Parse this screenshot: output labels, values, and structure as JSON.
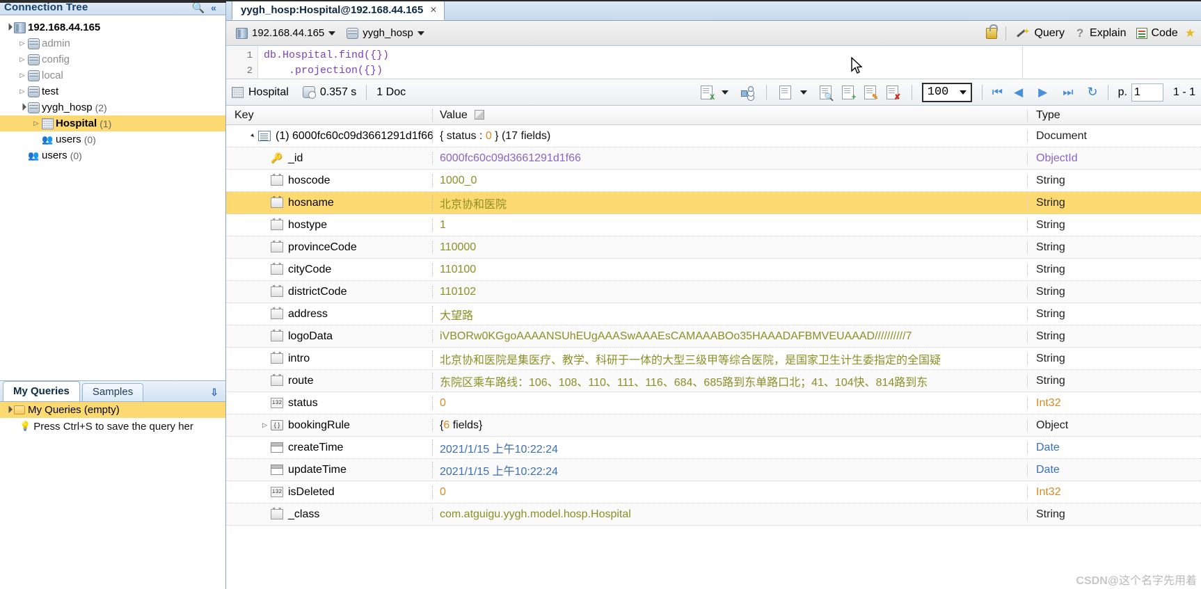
{
  "left_panel": {
    "header": {
      "title": "Connection Tree",
      "search_icon": "search-icon",
      "collapse_icon": "double-chevron-left-icon"
    },
    "tree": [
      {
        "label": "192.168.44.165",
        "count": "",
        "icon": "server-icon",
        "indent": 0,
        "expander": "open",
        "selected": false,
        "dim": false
      },
      {
        "label": "admin",
        "count": "",
        "icon": "database-icon",
        "indent": 1,
        "expander": "closed",
        "selected": false,
        "dim": true
      },
      {
        "label": "config",
        "count": "",
        "icon": "database-icon",
        "indent": 1,
        "expander": "closed",
        "selected": false,
        "dim": true
      },
      {
        "label": "local",
        "count": "",
        "icon": "database-icon",
        "indent": 1,
        "expander": "closed",
        "selected": false,
        "dim": true
      },
      {
        "label": "test",
        "count": "",
        "icon": "database-icon",
        "indent": 1,
        "expander": "closed",
        "selected": false,
        "dim": false
      },
      {
        "label": "yygh_hosp",
        "count": "(2)",
        "icon": "database-icon",
        "indent": 1,
        "expander": "open",
        "selected": false,
        "dim": false
      },
      {
        "label": "Hospital",
        "count": "(1)",
        "icon": "collection-icon",
        "indent": 2,
        "expander": "closed",
        "selected": true,
        "dim": false
      },
      {
        "label": "users",
        "count": "(0)",
        "icon": "users-icon",
        "indent": 2,
        "expander": "none",
        "selected": false,
        "dim": false
      },
      {
        "label": "users",
        "count": "(0)",
        "icon": "users-icon",
        "indent": 1,
        "expander": "none",
        "selected": false,
        "dim": false
      }
    ],
    "queries_panel": {
      "tabs": [
        {
          "label": "My Queries",
          "active": true
        },
        {
          "label": "Samples",
          "active": false
        }
      ],
      "expand_icon": "double-chevron-down-icon",
      "root_item": "My Queries (empty)",
      "hint": "Press Ctrl+S to save the query her"
    }
  },
  "main": {
    "editor_tab": {
      "title": "yygh_hosp:Hospital@192.168.44.165",
      "close": "×"
    },
    "connection_bar": {
      "server": "192.168.44.165",
      "database": "yygh_hosp",
      "lock_icon": "unlock-icon",
      "buttons": [
        {
          "label": "Query",
          "icon": "magic-wand-icon"
        },
        {
          "label": "Explain",
          "icon": "question-mark-icon"
        },
        {
          "label": "Code",
          "icon": "code-list-icon"
        }
      ],
      "favorite_icon": "star-icon"
    },
    "editor": {
      "lines": [
        {
          "no": "1",
          "text": "db.Hospital.find({})"
        },
        {
          "no": "2",
          "text": "    .projection({})"
        }
      ]
    },
    "result_toolbar": {
      "collection": "Hospital",
      "collection_icon": "collection-icon",
      "time": "0.357 s",
      "time_icon": "db-clock-icon",
      "doc_count": "1 Doc",
      "icons": [
        "export-excel-icon",
        "export-dropdown-caret",
        "tree-view-icon",
        "table-view-icon",
        "view-dropdown-caret",
        "view-document-icon",
        "add-document-icon",
        "edit-document-icon",
        "delete-document-icon"
      ],
      "limit": "100",
      "nav": {
        "first": "first-page-icon",
        "prev": "prev-page-icon",
        "next": "next-page-icon",
        "last": "last-page-icon",
        "refresh": "refresh-icon"
      },
      "page_label": "p.",
      "page_value": "1",
      "range_label": "1 - 1"
    },
    "grid": {
      "columns": [
        "Key",
        "Value",
        "Type"
      ],
      "value_header_icon": "edit-value-icon",
      "rows": [
        {
          "key": "(1) 6000fc60c09d3661291d1f66",
          "value": "{ status : 0 } (17 fields)",
          "value_prefix": "{ status : ",
          "value_num": "0",
          "value_suffix": " } (17 fields)",
          "type": "Document",
          "icon": "document-icon",
          "indent": 0,
          "expander": "open",
          "value_color": "black",
          "type_color": "gray",
          "highlight": false
        },
        {
          "key": "_id",
          "value": "6000fc60c09d3661291d1f66",
          "type": "ObjectId",
          "icon": "key-icon",
          "indent": 1,
          "expander": "none",
          "value_color": "purple",
          "type_color": "purple",
          "highlight": false
        },
        {
          "key": "hoscode",
          "value": "1000_0",
          "type": "String",
          "icon": "string-icon",
          "indent": 1,
          "expander": "none",
          "value_color": "green",
          "type_color": "gray",
          "highlight": false
        },
        {
          "key": "hosname",
          "value": "北京协和医院",
          "type": "String",
          "icon": "string-icon",
          "indent": 1,
          "expander": "none",
          "value_color": "green",
          "type_color": "gray",
          "highlight": true
        },
        {
          "key": "hostype",
          "value": "1",
          "type": "String",
          "icon": "string-icon",
          "indent": 1,
          "expander": "none",
          "value_color": "green",
          "type_color": "gray",
          "highlight": false
        },
        {
          "key": "provinceCode",
          "value": "110000",
          "type": "String",
          "icon": "string-icon",
          "indent": 1,
          "expander": "none",
          "value_color": "green",
          "type_color": "gray",
          "highlight": false
        },
        {
          "key": "cityCode",
          "value": "110100",
          "type": "String",
          "icon": "string-icon",
          "indent": 1,
          "expander": "none",
          "value_color": "green",
          "type_color": "gray",
          "highlight": false
        },
        {
          "key": "districtCode",
          "value": "110102",
          "type": "String",
          "icon": "string-icon",
          "indent": 1,
          "expander": "none",
          "value_color": "green",
          "type_color": "gray",
          "highlight": false
        },
        {
          "key": "address",
          "value": "大望路",
          "type": "String",
          "icon": "string-icon",
          "indent": 1,
          "expander": "none",
          "value_color": "green",
          "type_color": "gray",
          "highlight": false
        },
        {
          "key": "logoData",
          "value": "iVBORw0KGgoAAAANSUhEUgAAASwAAAEsCAMAAABOo35HAAADAFBMVEUAAAD//////////7",
          "type": "String",
          "icon": "string-icon",
          "indent": 1,
          "expander": "none",
          "value_color": "green",
          "type_color": "gray",
          "highlight": false
        },
        {
          "key": "intro",
          "value": "北京协和医院是集医疗、教学、科研于一体的大型三级甲等综合医院，是国家卫生计生委指定的全国疑",
          "type": "String",
          "icon": "string-icon",
          "indent": 1,
          "expander": "none",
          "value_color": "green",
          "type_color": "gray",
          "highlight": false
        },
        {
          "key": "route",
          "value": "东院区乘车路线：106、108、110、111、116、684、685路到东单路口北；41、104快、814路到东",
          "type": "String",
          "icon": "string-icon",
          "indent": 1,
          "expander": "none",
          "value_color": "green",
          "type_color": "gray",
          "highlight": false
        },
        {
          "key": "status",
          "value": "0",
          "type": "Int32",
          "icon": "int32-icon",
          "indent": 1,
          "expander": "none",
          "value_color": "orange",
          "type_color": "orange",
          "highlight": false
        },
        {
          "key": "bookingRule",
          "value": "{6 fields}",
          "value_prefix": "{",
          "value_num": "6",
          "value_suffix": " fields}",
          "type": "Object",
          "icon": "object-icon",
          "indent": 1,
          "expander": "closed",
          "value_color": "black",
          "type_color": "gray",
          "highlight": false
        },
        {
          "key": "createTime",
          "value": "2021/1/15 上午10:22:24",
          "type": "Date",
          "icon": "date-icon",
          "indent": 1,
          "expander": "none",
          "value_color": "blue",
          "type_color": "blue",
          "highlight": false
        },
        {
          "key": "updateTime",
          "value": "2021/1/15 上午10:22:24",
          "type": "Date",
          "icon": "date-icon",
          "indent": 1,
          "expander": "none",
          "value_color": "blue",
          "type_color": "blue",
          "highlight": false
        },
        {
          "key": "isDeleted",
          "value": "0",
          "type": "Int32",
          "icon": "int32-icon",
          "indent": 1,
          "expander": "none",
          "value_color": "orange",
          "type_color": "orange",
          "highlight": false
        },
        {
          "key": "_class",
          "value": "com.atguigu.yygh.model.hosp.Hospital",
          "type": "String",
          "icon": "string-icon",
          "indent": 1,
          "expander": "none",
          "value_color": "green",
          "type_color": "gray",
          "highlight": false
        }
      ]
    }
  },
  "watermark": {
    "site": "CSDN",
    "author": "@这个名字先用着"
  },
  "colors": {
    "selection": "#fcd971",
    "accent": "#2f6cb5",
    "string_value": "#8b8f25",
    "objectid_value": "#8a63c8",
    "number_value": "#d98b20",
    "date_value": "#3a6fb5"
  }
}
